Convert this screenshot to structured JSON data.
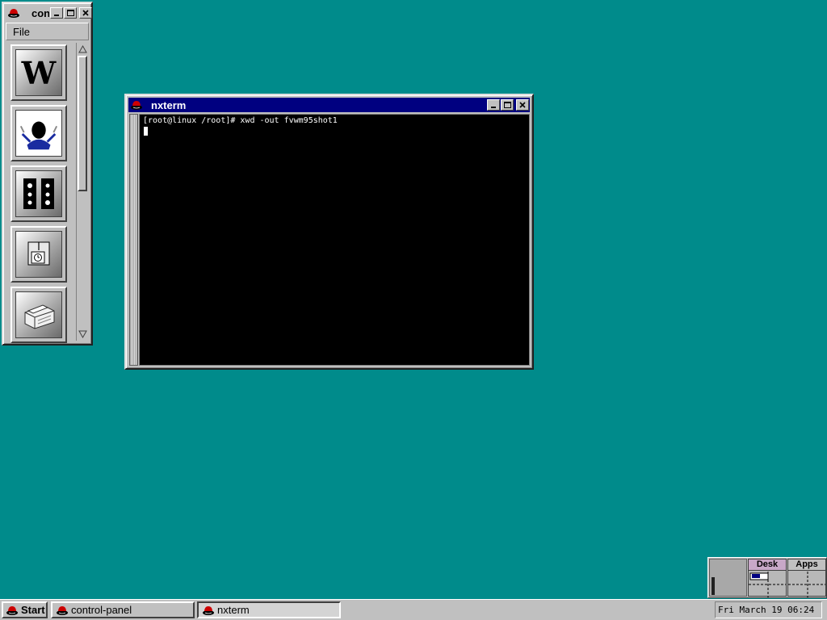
{
  "control_panel": {
    "title": "control-panel",
    "menu": {
      "file_label": "File"
    },
    "items": [
      {
        "name": "Windows"
      },
      {
        "name": "Users"
      },
      {
        "name": "Runlevel"
      },
      {
        "name": "Time"
      },
      {
        "name": "Printers"
      }
    ]
  },
  "nxterm": {
    "title": "nxterm",
    "prompt_line": "[root@linux /root]# xwd -out fvwm95shot1"
  },
  "taskbar": {
    "start_label": "Start",
    "tasks": [
      {
        "label": "control-panel"
      },
      {
        "label": "nxterm"
      }
    ],
    "clock": "Fri March 19 06:24"
  },
  "pager": {
    "desk_label": "Desk",
    "apps_label": "Apps"
  },
  "colors": {
    "desktop": "#008b8b",
    "active_title": "#000080",
    "chrome": "#c0c0c0"
  }
}
